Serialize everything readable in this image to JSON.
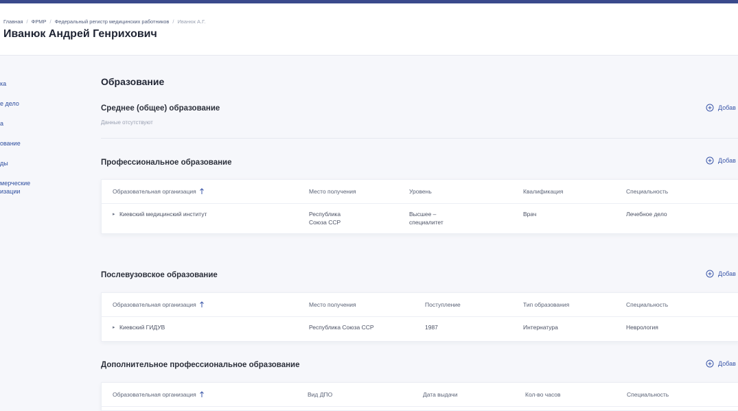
{
  "breadcrumb": {
    "items": [
      "Главная",
      "ФРМР",
      "Федеральный регистр медицинских работников"
    ],
    "current": "Иванюк А.Г."
  },
  "page": {
    "title": "Иванюк Андрей Генрихович"
  },
  "sidebar": {
    "items": [
      "ка",
      "е дело",
      "а",
      "ование",
      "ды",
      "мерческие",
      "изации"
    ]
  },
  "education": {
    "title": "Образование",
    "add_label": "Добав",
    "secondary": {
      "title": "Среднее (общее) образование",
      "empty": "Данные отсутствуют"
    },
    "professional": {
      "title": "Профессиональное образование",
      "columns": [
        "Образовательная организация",
        "Место получения",
        "Уровень",
        "Квалификация",
        "Специальность"
      ],
      "rows": [
        {
          "org": "Киевский медицинский институт",
          "place": "Республика\nСоюза ССР",
          "level": "Высшее –\nспециалитет",
          "qualification": "Врач",
          "specialty": "Лечебное дело"
        }
      ]
    },
    "postgraduate": {
      "title": "Послевузовское образование",
      "columns": [
        "Образовательная организация",
        "Место получения",
        "Поступление",
        "Тип образования",
        "Специальность"
      ],
      "rows": [
        {
          "org": "Киевский ГИДУВ",
          "place": "Республика Союза ССР",
          "admission": "1987",
          "type": "Интернатура",
          "specialty": "Неврология"
        }
      ]
    },
    "additional": {
      "title": "Дополнительное профессиональное образование",
      "columns": [
        "Образовательная организация",
        "Вид ДПО",
        "Дата выдачи",
        "Кол-во часов",
        "Специальность"
      ]
    }
  },
  "colors": {
    "accent": "#3a56a8",
    "topbar": "#3a4a8c"
  }
}
